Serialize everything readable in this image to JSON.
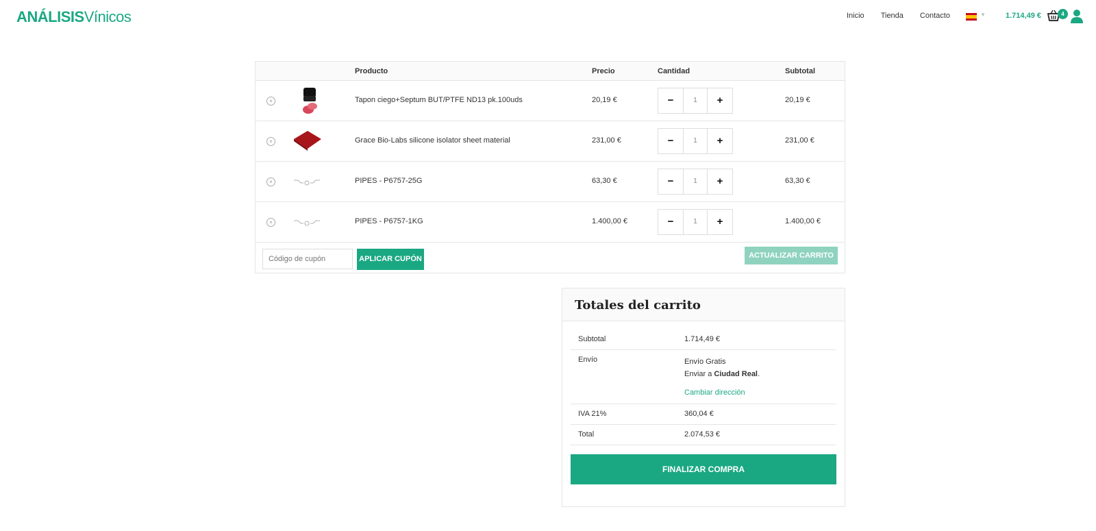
{
  "header": {
    "logo_bold": "ANÁLISIS",
    "logo_light": "Vínicos",
    "nav": [
      "Inicio",
      "Tienda",
      "Contacto"
    ],
    "cart_total": "1.714,49 €",
    "cart_count": "4",
    "flag_icon": "spain-flag-icon",
    "colors": {
      "accent": "#1aa882"
    }
  },
  "cart": {
    "headers": {
      "product": "Producto",
      "price": "Precio",
      "quantity": "Cantidad",
      "subtotal": "Subtotal"
    },
    "items": [
      {
        "name": "Tapon ciego+Septum BUT/PTFE ND13 pk.100uds",
        "price": "20,19 €",
        "qty": "1",
        "subtotal": "20,19 €",
        "thumb": "vial-cap-icon"
      },
      {
        "name": "Grace Bio-Labs silicone isolator sheet material",
        "price": "231,00 €",
        "qty": "1",
        "subtotal": "231,00 €",
        "thumb": "red-sheet-icon"
      },
      {
        "name": "PIPES - P6757-25G",
        "price": "63,30 €",
        "qty": "1",
        "subtotal": "63,30 €",
        "thumb": "molecule-icon"
      },
      {
        "name": "PIPES - P6757-1KG",
        "price": "1.400,00 €",
        "qty": "1",
        "subtotal": "1.400,00 €",
        "thumb": "molecule-icon"
      }
    ],
    "minus": "−",
    "plus": "+",
    "remove": "×",
    "coupon_placeholder": "Código de cupón",
    "apply_coupon": "APLICAR CUPÓN",
    "update_cart": "ACTUALIZAR CARRITO"
  },
  "totals": {
    "title": "Totales del carrito",
    "subtotal_label": "Subtotal",
    "subtotal_value": "1.714,49 €",
    "shipping_label": "Envío",
    "shipping_value": "Envío Gratis",
    "ship_to_prefix": "Enviar a ",
    "ship_to_city": "Ciudad Real",
    "ship_to_suffix": ".",
    "change_address": "Cambiar dirección",
    "tax_label": "IVA 21%",
    "tax_value": "360,04 €",
    "total_label": "Total",
    "total_value": "2.074,53 €",
    "checkout": "FINALIZAR COMPRA"
  }
}
